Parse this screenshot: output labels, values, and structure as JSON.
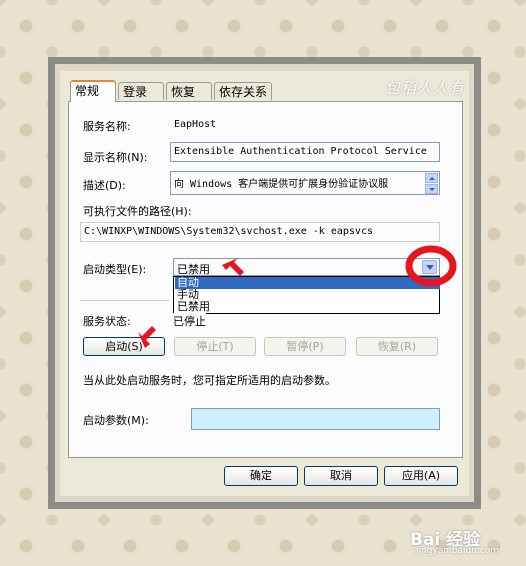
{
  "watermark_top": "包稻人人有",
  "watermark_bottom": "Bai 经验",
  "watermark_url": "jingyan.baidu.com",
  "tabs": [
    {
      "label": "常规",
      "active": true
    },
    {
      "label": "登录",
      "active": false
    },
    {
      "label": "恢复",
      "active": false
    },
    {
      "label": "依存关系",
      "active": false
    }
  ],
  "service_name": {
    "label": "服务名称:",
    "value": "EapHost"
  },
  "display_name": {
    "label": "显示名称(N):",
    "value": "Extensible Authentication Protocol Service"
  },
  "description": {
    "label": "描述(D):",
    "value": "向 Windows 客户端提供可扩展身份验证协议服"
  },
  "exe_path": {
    "label": "可执行文件的路径(H):",
    "value": "C:\\WINXP\\WINDOWS\\System32\\svchost.exe -k eapsvcs"
  },
  "startup_type": {
    "label": "启动类型(E):",
    "selected": "已禁用",
    "options": [
      "自动",
      "手动",
      "已禁用"
    ],
    "highlighted": "自动"
  },
  "service_status": {
    "label": "服务状态:",
    "value": "已停止"
  },
  "control_buttons": {
    "start": "启动(S)",
    "stop": "停止(T)",
    "pause": "暂停(P)",
    "resume": "恢复(R)"
  },
  "hint_text": "当从此处启动服务时，您可指定所适用的启动参数。",
  "start_params": {
    "label": "启动参数(M):",
    "value": ""
  },
  "dialog_buttons": {
    "ok": "确定",
    "cancel": "取消",
    "apply": "应用(A)"
  },
  "colors": {
    "highlight": "#316ac5",
    "annotation_red": "#e8141e",
    "input_bg": "#cfeffe"
  }
}
